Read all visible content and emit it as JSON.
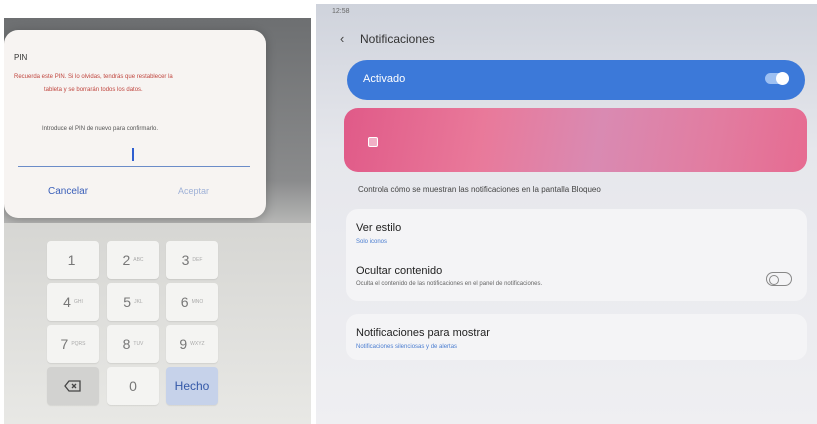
{
  "pin_dialog": {
    "title": "PIN",
    "warning_line1": "Recuerda este PIN. Si lo olvidas, tendrás que restablecer la",
    "warning_line2": "tableta y se borrarán todos los datos.",
    "instruction": "Introduce el PIN de nuevo para confirmarlo.",
    "input_value": "",
    "cancel_label": "Cancelar",
    "accept_label": "Aceptar"
  },
  "keypad": {
    "keys": [
      {
        "num": "1",
        "sub": ""
      },
      {
        "num": "2",
        "sub": "ABC"
      },
      {
        "num": "3",
        "sub": "DEF"
      },
      {
        "num": "4",
        "sub": "GHI"
      },
      {
        "num": "5",
        "sub": "JKL"
      },
      {
        "num": "6",
        "sub": "MNO"
      },
      {
        "num": "7",
        "sub": "PQRS"
      },
      {
        "num": "8",
        "sub": "TUV"
      },
      {
        "num": "9",
        "sub": "WXYZ"
      },
      {
        "num": "0",
        "sub": ""
      }
    ],
    "done_label": "Hecho",
    "backspace_icon": "backspace-icon"
  },
  "notifications": {
    "status_time": "12:58",
    "screen_title": "Notificaciones",
    "toggle_label": "Activado",
    "toggle_on": true,
    "lock_description": "Controla cómo se muestran las notificaciones en la pantalla Bloqueo",
    "ver_estilo": {
      "title": "Ver estilo",
      "subtitle": "Solo iconos"
    },
    "ocultar_contenido": {
      "title": "Ocultar contenido",
      "subtitle": "Oculta el contenido de las notificaciones en el panel de notificaciones.",
      "enabled": false
    },
    "notif_mostrar": {
      "title": "Notificaciones para mostrar",
      "subtitle": "Notificaciones silenciosas y de alertas"
    }
  },
  "colors": {
    "accent_blue": "#3c79d9",
    "warning_red": "#c0463f",
    "wallpaper_pink": "#e05a88"
  }
}
